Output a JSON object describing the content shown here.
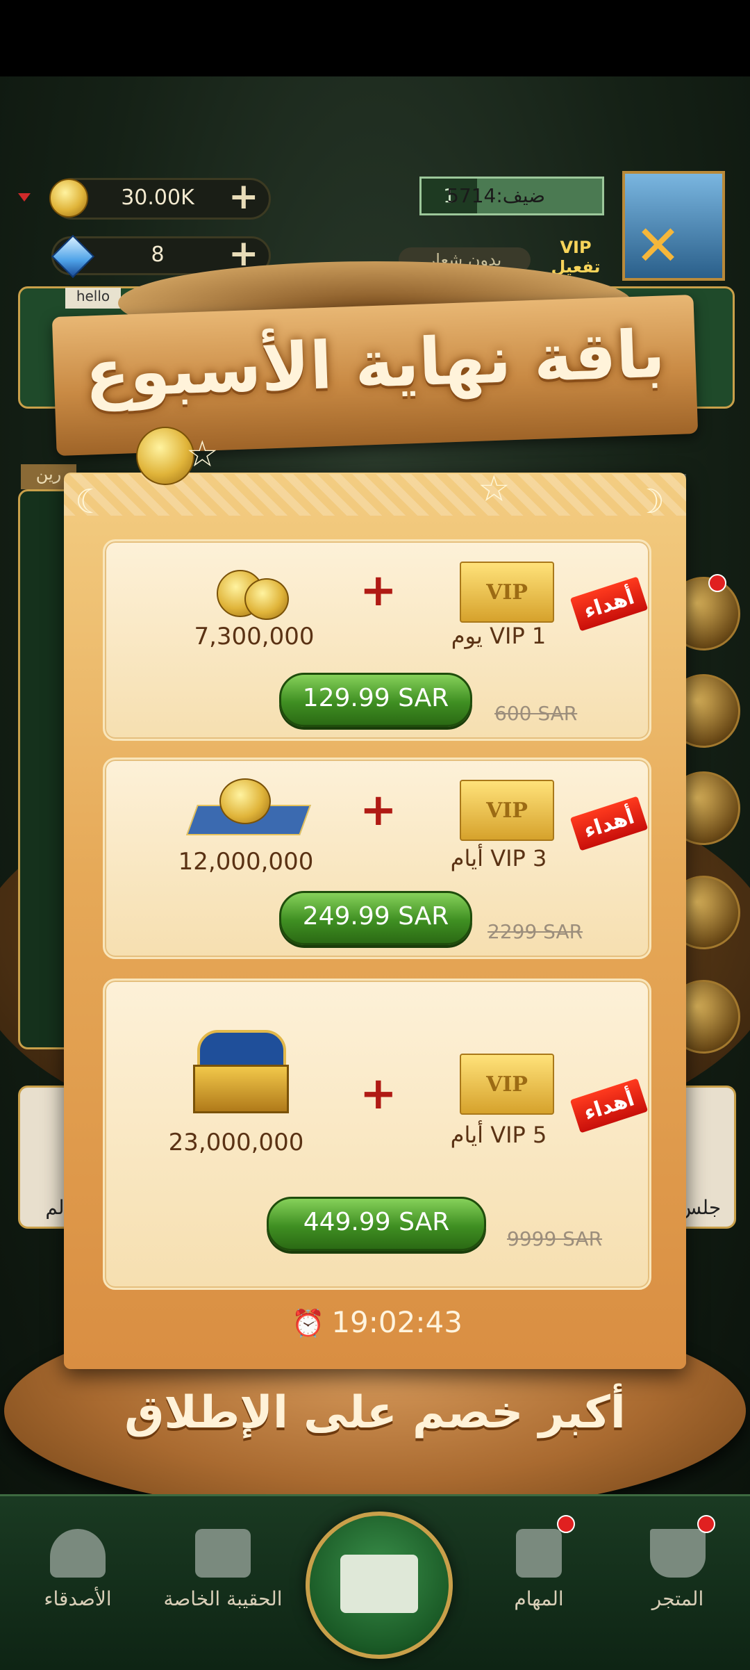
{
  "top_bar": {
    "coins": "30.00K",
    "gems": "8",
    "guest_label": "ضيف:5714",
    "level": "1",
    "no_emblem": "بدون شعار",
    "vip_activate": "VIP تفعيل",
    "plus_symbol": "+"
  },
  "background": {
    "hello_tag": "hello",
    "side_label": "رين",
    "card_left_label": "لم",
    "card_right_label": "جلس"
  },
  "popup": {
    "title": "باقة نهاية الأسبوع",
    "packages": [
      {
        "gift_tag": "أهداء",
        "vip_card": "VIP",
        "vip_label": "1 VIP يوم",
        "plus": "+",
        "amount": "7,300,000",
        "price": "129.99 SAR",
        "old_price": "600 SAR"
      },
      {
        "gift_tag": "أهداء",
        "vip_card": "VIP",
        "vip_label": "3 VIP أيام",
        "plus": "+",
        "amount": "12,000,000",
        "price": "249.99 SAR",
        "old_price": "2299 SAR"
      },
      {
        "gift_tag": "أهداء",
        "vip_card": "VIP",
        "vip_label": "5 VIP أيام",
        "plus": "+",
        "amount": "23,000,000",
        "price": "449.99 SAR",
        "old_price": "9999 SAR"
      }
    ],
    "timer": "19:02:43",
    "slogan": "أكبر خصم على الإطلاق"
  },
  "bottom_nav": {
    "friends": "الأصدقاء",
    "bag": "الحقيبة الخاصة",
    "tasks": "المهام",
    "shop": "المتجر"
  }
}
